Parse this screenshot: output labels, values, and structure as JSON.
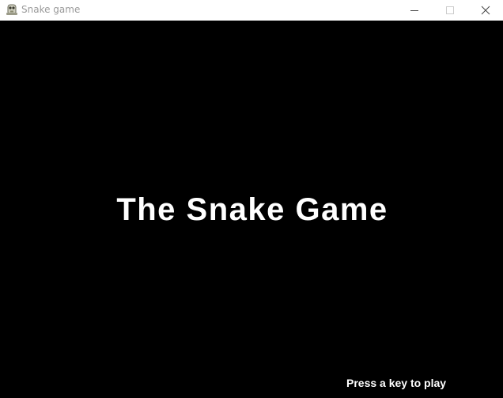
{
  "window": {
    "title": "Snake game",
    "icon": "pygame-snake-icon",
    "controls": [
      "minimize-icon",
      "maximize-icon",
      "close-icon"
    ]
  },
  "game": {
    "title": "The Snake Game",
    "prompt": "Press a key to play",
    "colors": {
      "background": "#000000",
      "text": "#ffffff"
    }
  }
}
